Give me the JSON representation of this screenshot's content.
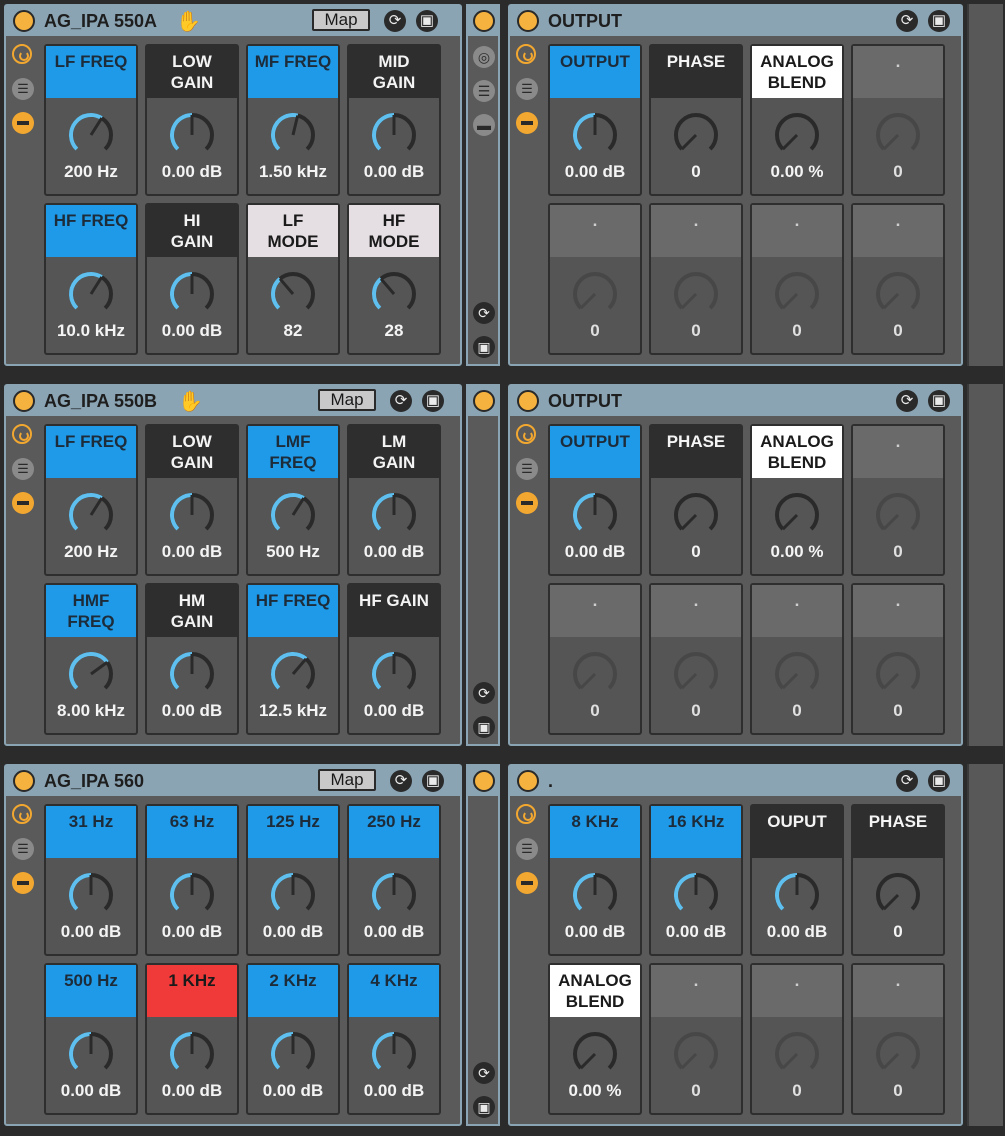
{
  "colors": {
    "accent": "#f6b23e",
    "blue": "#1f9ae8",
    "red": "#f03a3a",
    "title": "#8aa4b4"
  },
  "icons": {
    "power": "power-icon",
    "hand": "hand-icon",
    "refresh": "refresh-icon",
    "save": "save-icon",
    "list": "list-icon",
    "config": "config-icon"
  },
  "racks": [
    {
      "eq": {
        "title": "AG_IPA 550A",
        "map": "Map",
        "hand": true,
        "cells": [
          {
            "label": "LF FREQ",
            "style": "blue",
            "value": "200 Hz",
            "knob": 0.62
          },
          {
            "label": "LOW\nGAIN",
            "style": "dark",
            "value": "0.00 dB",
            "knob": 0.5
          },
          {
            "label": "MF FREQ",
            "style": "blue",
            "value": "1.50 kHz",
            "knob": 0.55
          },
          {
            "label": "MID\nGAIN",
            "style": "dark",
            "value": "0.00 dB",
            "knob": 0.5
          },
          {
            "label": "HF FREQ",
            "style": "blue",
            "value": "10.0 kHz",
            "knob": 0.62
          },
          {
            "label": "HI\nGAIN",
            "style": "dark",
            "value": "0.00 dB",
            "knob": 0.5
          },
          {
            "label": "LF\nMODE",
            "style": "pale",
            "value": "82",
            "knob": 0.35
          },
          {
            "label": "HF\nMODE",
            "style": "pale",
            "value": "28",
            "knob": 0.35
          }
        ]
      },
      "out": {
        "title": "OUTPUT",
        "cells": [
          {
            "label": "OUTPUT",
            "style": "blue",
            "value": "0.00 dB",
            "knob": 0.5
          },
          {
            "label": "PHASE",
            "style": "dark",
            "value": "0",
            "knob": 0.0
          },
          {
            "label": "ANALOG\nBLEND",
            "style": "white",
            "value": "0.00 %",
            "knob": 0.0
          },
          {
            "label": ".",
            "style": "grey",
            "value": "0",
            "knob": 0.0,
            "dim": true
          },
          {
            "label": ".",
            "style": "grey",
            "value": "0",
            "knob": 0.0,
            "dim": true
          },
          {
            "label": ".",
            "style": "grey",
            "value": "0",
            "knob": 0.0,
            "dim": true
          },
          {
            "label": ".",
            "style": "grey",
            "value": "0",
            "knob": 0.0,
            "dim": true
          },
          {
            "label": ".",
            "style": "grey",
            "value": "0",
            "knob": 0.0,
            "dim": true
          }
        ]
      }
    },
    {
      "eq": {
        "title": "AG_IPA 550B",
        "map": "Map",
        "hand": true,
        "cells": [
          {
            "label": "LF  FREQ",
            "style": "blue",
            "value": "200 Hz",
            "knob": 0.62
          },
          {
            "label": "LOW\nGAIN",
            "style": "dark",
            "value": "0.00 dB",
            "knob": 0.5
          },
          {
            "label": "LMF\nFREQ",
            "style": "blue",
            "value": "500 Hz",
            "knob": 0.62
          },
          {
            "label": "LM\nGAIN",
            "style": "dark",
            "value": "0.00 dB",
            "knob": 0.5
          },
          {
            "label": "HMF\nFREQ",
            "style": "blue",
            "value": "8.00 kHz",
            "knob": 0.7
          },
          {
            "label": "HM\nGAIN",
            "style": "dark",
            "value": "0.00 dB",
            "knob": 0.5
          },
          {
            "label": "HF FREQ",
            "style": "blue",
            "value": "12.5 kHz",
            "knob": 0.65
          },
          {
            "label": "HF  GAIN",
            "style": "dark",
            "value": "0.00 dB",
            "knob": 0.5
          }
        ]
      },
      "out": {
        "title": "OUTPUT",
        "cells": [
          {
            "label": "OUTPUT",
            "style": "blue",
            "value": "0.00 dB",
            "knob": 0.5
          },
          {
            "label": "PHASE",
            "style": "dark",
            "value": "0",
            "knob": 0.0
          },
          {
            "label": "ANALOG\nBLEND",
            "style": "white",
            "value": "0.00 %",
            "knob": 0.0
          },
          {
            "label": ".",
            "style": "grey",
            "value": "0",
            "knob": 0.0,
            "dim": true
          },
          {
            "label": ".",
            "style": "grey",
            "value": "0",
            "knob": 0.0,
            "dim": true
          },
          {
            "label": ".",
            "style": "grey",
            "value": "0",
            "knob": 0.0,
            "dim": true
          },
          {
            "label": ".",
            "style": "grey",
            "value": "0",
            "knob": 0.0,
            "dim": true
          },
          {
            "label": ".",
            "style": "grey",
            "value": "0",
            "knob": 0.0,
            "dim": true
          }
        ]
      }
    },
    {
      "eq": {
        "title": "AG_IPA 560",
        "map": "Map",
        "hand": false,
        "cells": [
          {
            "label": "31 Hz",
            "style": "blue",
            "value": "0.00 dB",
            "knob": 0.5
          },
          {
            "label": "63 Hz",
            "style": "blue",
            "value": "0.00 dB",
            "knob": 0.5
          },
          {
            "label": "125 Hz",
            "style": "blue",
            "value": "0.00 dB",
            "knob": 0.5
          },
          {
            "label": "250 Hz",
            "style": "blue",
            "value": "0.00 dB",
            "knob": 0.5
          },
          {
            "label": "500 Hz",
            "style": "blue",
            "value": "0.00 dB",
            "knob": 0.5
          },
          {
            "label": "1 KHz",
            "style": "red",
            "value": "0.00 dB",
            "knob": 0.5
          },
          {
            "label": "2 KHz",
            "style": "blue",
            "value": "0.00 dB",
            "knob": 0.5
          },
          {
            "label": "4 KHz",
            "style": "blue",
            "value": "0.00 dB",
            "knob": 0.5
          }
        ]
      },
      "out": {
        "title": ".",
        "cells": [
          {
            "label": "8 KHz",
            "style": "blue",
            "value": "0.00 dB",
            "knob": 0.5
          },
          {
            "label": "16 KHz",
            "style": "blue",
            "value": "0.00 dB",
            "knob": 0.5
          },
          {
            "label": "OUPUT",
            "style": "dark",
            "value": "0.00 dB",
            "knob": 0.5
          },
          {
            "label": "PHASE",
            "style": "dark",
            "value": "0",
            "knob": 0.0
          },
          {
            "label": "ANALOG\nBLEND",
            "style": "white",
            "value": "0.00 %",
            "knob": 0.0
          },
          {
            "label": ".",
            "style": "grey",
            "value": "0",
            "knob": 0.0,
            "dim": true
          },
          {
            "label": ".",
            "style": "grey",
            "value": "0",
            "knob": 0.0,
            "dim": true
          },
          {
            "label": ".",
            "style": "grey",
            "value": "0",
            "knob": 0.0,
            "dim": true
          }
        ]
      }
    }
  ]
}
